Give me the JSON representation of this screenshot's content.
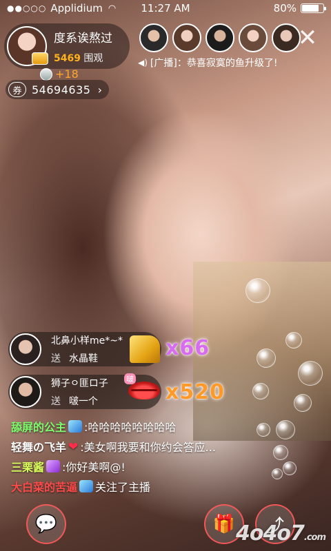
{
  "status_bar": {
    "signal": "●●○○○",
    "carrier": "Applidium",
    "time": "11:27 AM",
    "battery": "80%",
    "battery_level": 0.8
  },
  "host": {
    "name": "度系诶熬过",
    "viewers_count": "5469",
    "viewers_label": "围观",
    "gain": "+18"
  },
  "ticket": {
    "icon": "券",
    "count": "54694635",
    "arrow": "›"
  },
  "top_bar": {
    "close_icon": "✕"
  },
  "broadcast": {
    "text": "[广播]：恭喜寂寞的鱼升级了!"
  },
  "gifts": [
    {
      "sender": "北鼻小样me*~*",
      "action": "送",
      "gift": "水晶鞋",
      "combo": "x66"
    },
    {
      "sender": "狮子ㅇ匪ロ子",
      "action": "送",
      "gift": "啵一个",
      "combo": "x520"
    }
  ],
  "gift_badge": "啵",
  "chat": [
    {
      "user": "舔屏的公主",
      "badge": "gem",
      "message": ":哈哈哈哈哈哈哈哈"
    },
    {
      "user": "轻舞の飞羊",
      "badge": "heart",
      "badge_glyph": "❤",
      "message": ":美女啊我要和你约会答应..."
    },
    {
      "user": "三栗酱",
      "badge": "vip",
      "message": ":你好美啊@!"
    },
    {
      "user": "大白菜的苦逼",
      "badge": "gem",
      "message": "关注了主播"
    }
  ],
  "bottom": {
    "chat_icon": "💬",
    "gift_icon": "🎁",
    "share_icon": "⤴"
  },
  "watermark": {
    "main": "4o4o7",
    "suffix": ".com"
  },
  "colors": {
    "accent_orange": "#ffa62b",
    "combo_purple": "#d86cf0",
    "combo_orange": "#ff9a2a"
  }
}
